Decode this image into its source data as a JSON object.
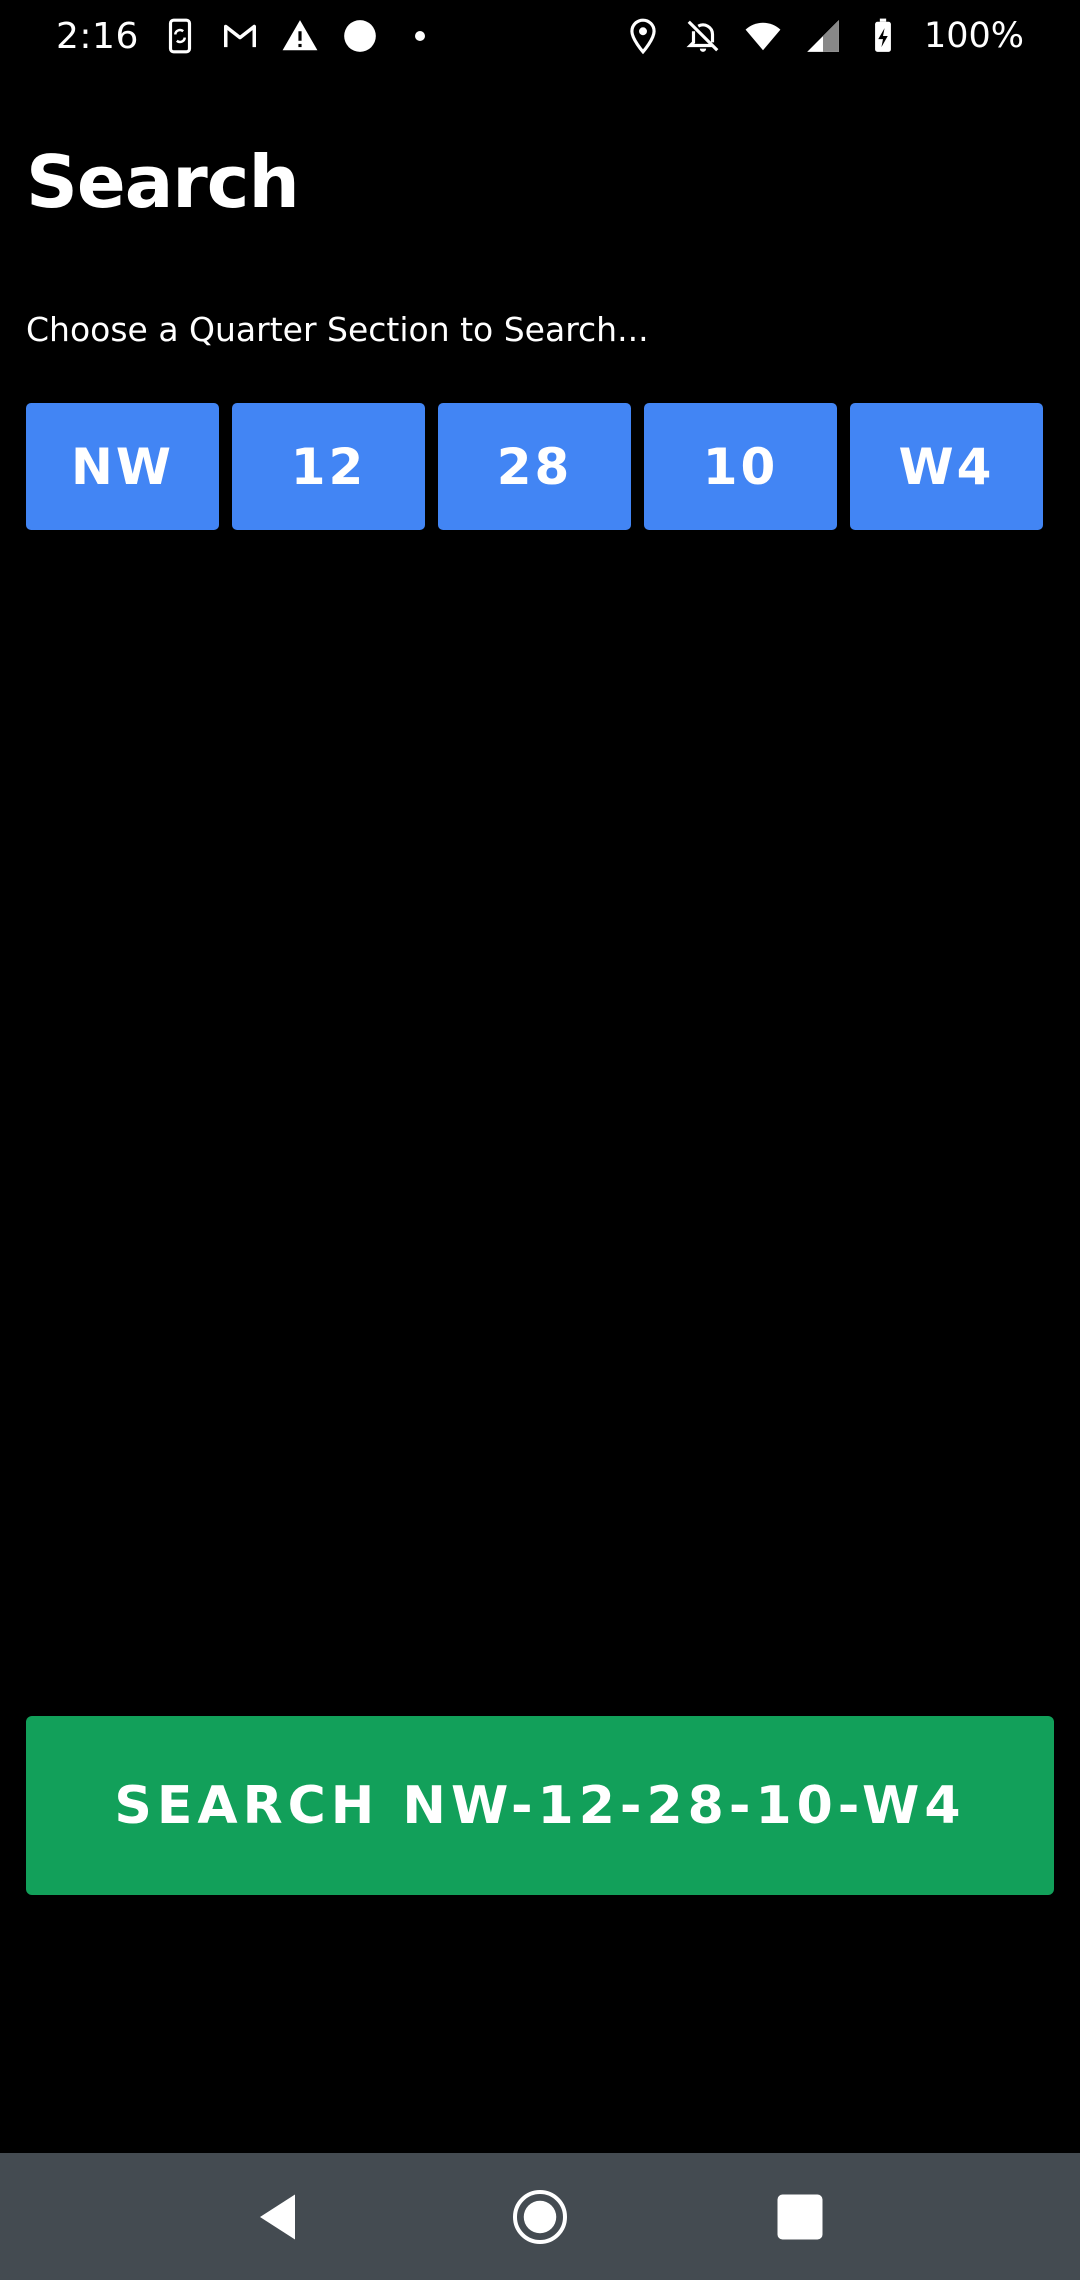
{
  "status_bar": {
    "time": "2:16",
    "battery_text": "100%",
    "left_icons": [
      "sync-phone-icon",
      "gmail-icon",
      "warning-icon",
      "circle-icon",
      "dot-icon"
    ],
    "right_icons": [
      "location-icon",
      "bell-off-icon",
      "wifi-icon",
      "signal-icon",
      "battery-charging-icon"
    ]
  },
  "page": {
    "title": "Search",
    "subtitle": "Choose a Quarter Section to Search..."
  },
  "selectors": [
    {
      "label": "NW"
    },
    {
      "label": "12"
    },
    {
      "label": "28"
    },
    {
      "label": "10"
    },
    {
      "label": "W4"
    }
  ],
  "search_button": {
    "label": "SEARCH NW-12-28-10-W4"
  },
  "colors": {
    "background": "#000000",
    "selector_blue": "#4285f4",
    "search_green": "#12a05a",
    "nav_bar": "#444b51"
  },
  "nav_bar": {
    "buttons": [
      "back-icon",
      "home-icon",
      "recents-icon"
    ]
  }
}
